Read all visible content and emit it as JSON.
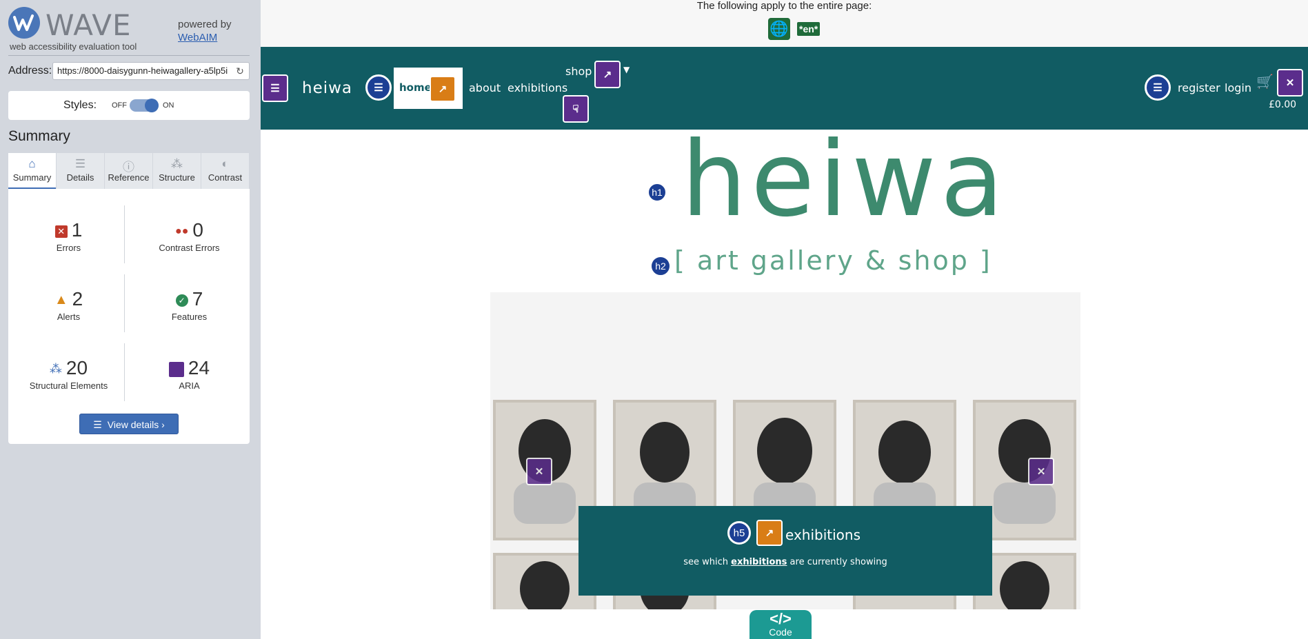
{
  "wave": {
    "brand": "WAVE",
    "tagline": "web accessibility evaluation tool",
    "powered_by": "powered by",
    "powered_link": "WebAIM",
    "address_label": "Address:",
    "address_value": "https://8000-daisygunn-heiwagallery-a5lp5i",
    "styles_label": "Styles:",
    "styles_off": "OFF",
    "styles_on": "ON",
    "summary_title": "Summary",
    "tabs": [
      {
        "label": "Summary",
        "icon": "home-icon"
      },
      {
        "label": "Details",
        "icon": "list-icon"
      },
      {
        "label": "Reference",
        "icon": "info-icon"
      },
      {
        "label": "Structure",
        "icon": "hierarchy-icon"
      },
      {
        "label": "Contrast",
        "icon": "contrast-icon"
      }
    ],
    "stats": {
      "errors": {
        "count": "1",
        "label": "Errors"
      },
      "contrast": {
        "count": "0",
        "label": "Contrast Errors"
      },
      "alerts": {
        "count": "2",
        "label": "Alerts"
      },
      "features": {
        "count": "7",
        "label": "Features"
      },
      "structural": {
        "count": "20",
        "label": "Structural Elements"
      },
      "aria": {
        "count": "24",
        "label": "ARIA"
      }
    },
    "view_details": "View details ›"
  },
  "page": {
    "notice": "The following apply to the entire page:",
    "lang_badge": "*en*",
    "site_name": "heiwa",
    "nav": {
      "home": "home",
      "about": "about",
      "exhibitions": "exhibitions",
      "shop": "shop",
      "register": "register",
      "login": "login",
      "basket_total": "£0.00"
    },
    "hero_title": "heiwa",
    "hero_subtitle": "[ art gallery & shop ]",
    "h1_badge": "h1",
    "h2_badge": "h2",
    "h5_badge": "h5",
    "overlay_title": "exhibitions",
    "overlay_text_pre": "see which ",
    "overlay_link": "exhibitions",
    "overlay_text_post": " are currently showing",
    "code_label": "Code",
    "code_glyph": "</>"
  },
  "colors": {
    "nav_bg": "#115c63",
    "brand_green": "#3d8a6e",
    "wave_blue": "#3e6db5",
    "sidebar_bg": "#d3d7de"
  }
}
